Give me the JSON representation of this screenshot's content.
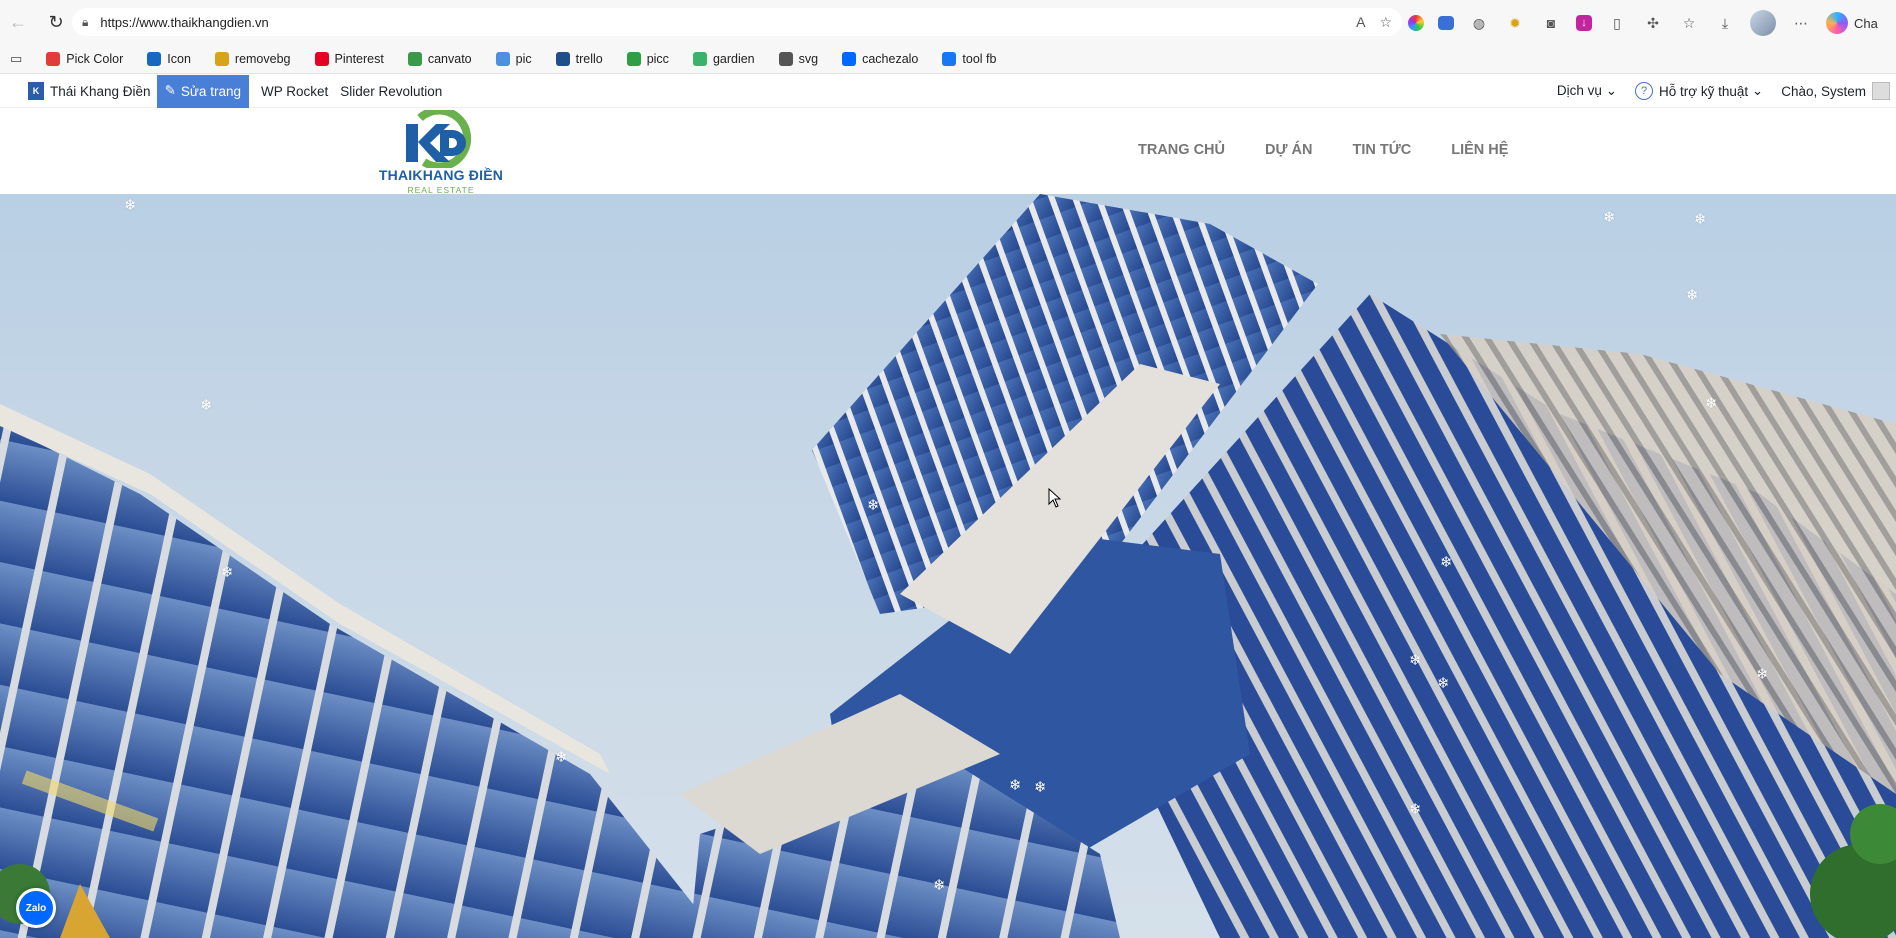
{
  "browser": {
    "url": "https://www.thaikhangdien.vn",
    "profile_label": "Cha"
  },
  "bookmarks": [
    {
      "label": "Pick Color",
      "icon": "color-wheel-icon",
      "color": "#e23b3b"
    },
    {
      "label": "Icon",
      "icon": "vuetify-icon",
      "color": "#1867c0"
    },
    {
      "label": "removebg",
      "icon": "removebg-icon",
      "color": "#d9a21b"
    },
    {
      "label": "Pinterest",
      "icon": "pinterest-icon",
      "color": "#e60023"
    },
    {
      "label": "canvato",
      "icon": "canvato-icon",
      "color": "#3a9a4a"
    },
    {
      "label": "pic",
      "icon": "pic-icon",
      "color": "#4f8fe0"
    },
    {
      "label": "trello",
      "icon": "trello-icon",
      "color": "#1f4f8a"
    },
    {
      "label": "picc",
      "icon": "picc-icon",
      "color": "#2f9e45"
    },
    {
      "label": "gardien",
      "icon": "gardien-icon",
      "color": "#3ab26b"
    },
    {
      "label": "svg",
      "icon": "globe-icon",
      "color": "#555555"
    },
    {
      "label": "cachezalo",
      "icon": "zalo-icon",
      "color": "#0068ff"
    },
    {
      "label": "tool fb",
      "icon": "facebook-icon",
      "color": "#1877f2"
    }
  ],
  "admin_bar": {
    "site_name": "Thái Khang Điền",
    "edit_label": "Sửa trang",
    "wp_rocket": "WP Rocket",
    "slider_revolution": "Slider Revolution",
    "services": "Dịch vụ",
    "support": "Hỗ trợ kỹ thuật",
    "greeting": "Chào, System"
  },
  "site": {
    "logo_text": "THAIKHANG ĐIỀN",
    "logo_sub": "REAL ESTATE",
    "nav": [
      "TRANG CHỦ",
      "DỰ ÁN",
      "TIN TỨC",
      "LIÊN HỆ"
    ]
  },
  "zalo_label": "Zalo",
  "colors": {
    "brand_blue": "#1f5fa6",
    "brand_green": "#6ab04c",
    "edit_accent": "#4a7fd8"
  }
}
